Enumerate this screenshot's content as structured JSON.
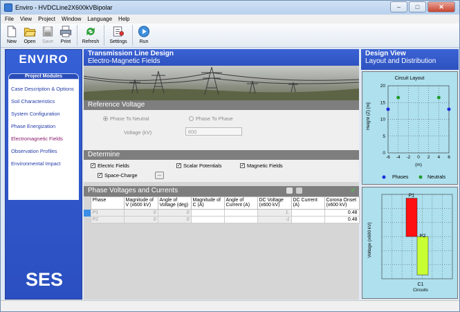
{
  "window": {
    "title": "Enviro - HVDCLine2X600kVBipolar",
    "minimize": "–",
    "maximize": "□",
    "close": "✕"
  },
  "menu": [
    "File",
    "View",
    "Project",
    "Window",
    "Language",
    "Help"
  ],
  "toolbar": {
    "new": "New",
    "open": "Open",
    "save": "Save",
    "print": "Print",
    "refresh": "Refresh",
    "settings": "Settings",
    "run": "Run"
  },
  "left": {
    "brand": "ENVIRO",
    "modules_header": "Project Modules",
    "modules": [
      "Case Description & Options",
      "Soil Characteristics",
      "System Configuration",
      "Phase Energization",
      "Electromagnetic Fields",
      "Observation Profiles",
      "Environmental Impact"
    ],
    "logo": "SES"
  },
  "center": {
    "title": "Transmission Line Design",
    "subtitle": "Electro-Magnetic Fields",
    "ref_voltage": {
      "header": "Reference Voltage",
      "opt1": "Phase To Neutral",
      "opt2": "Phase To Phase",
      "voltage_label": "Voltage (kV)",
      "voltage_value": "600"
    },
    "determine": {
      "header": "Determine",
      "electric": "Electric Fields",
      "space_charge": "Space-Charge",
      "dots": "...",
      "scalar": "Scalar Potentials",
      "magnetic": "Magnetic Fields"
    },
    "phase": {
      "header": "Phase Voltages and Currents",
      "columns": [
        "Phase",
        "Magnitude of V (x600 kV)",
        "Angle of Voltage (deg)",
        "Magnitude of C (A)",
        "Angle of Current (A)",
        "DC Voltage (x600 kV)",
        "DC Current (A)",
        "Corona Onset (x600 kV)"
      ],
      "rows": [
        [
          "P1",
          "0",
          "0",
          "",
          "",
          "1.",
          "",
          "0.48"
        ],
        [
          "P2",
          "0",
          "0",
          "",
          "",
          "-1",
          "",
          "0.48"
        ]
      ]
    }
  },
  "right": {
    "title": "Design View",
    "subtitle": "Layout and Distribution",
    "layout_title": "Circuit Layout",
    "layout_ylabel": "Height (Z) [m]",
    "layout_xlabel": "(m)",
    "legend_phases": "Phases",
    "legend_neutrals": "Neutrals",
    "bar_ylabel": "Voltage (x600 kV)",
    "bar_xlabel": "Circuits",
    "bar_circuit": "C1"
  },
  "chart_data": [
    {
      "type": "scatter",
      "title": "Circuit Layout",
      "xlabel": "(m)",
      "ylabel": "Height (Z) [m]",
      "xlim": [
        -6,
        6
      ],
      "ylim": [
        0,
        20
      ],
      "xticks": [
        -6,
        -4,
        -2,
        0,
        2,
        4,
        6
      ],
      "yticks": [
        0,
        5,
        10,
        15,
        20
      ],
      "grid": true,
      "legend": "bottom",
      "series": [
        {
          "name": "Phases",
          "color": "#1a2fe0",
          "points": [
            [
              -6,
              13
            ],
            [
              6,
              13
            ]
          ]
        },
        {
          "name": "Neutrals",
          "color": "#1f9a2a",
          "points": [
            [
              -4,
              16.5
            ],
            [
              4,
              16.5
            ]
          ]
        }
      ]
    },
    {
      "type": "bar",
      "xlabel": "Circuits",
      "ylabel": "Voltage (x600 kV)",
      "categories": [
        "C1"
      ],
      "series": [
        {
          "name": "P1",
          "values": [
            1
          ],
          "color": "#ff1010"
        },
        {
          "name": "P2",
          "values": [
            -1
          ],
          "color": "#c8ff33"
        }
      ],
      "grid": true
    }
  ]
}
